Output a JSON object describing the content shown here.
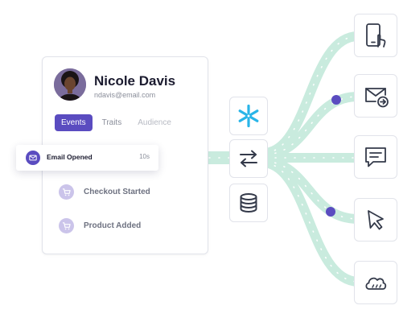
{
  "profile": {
    "name": "Nicole Davis",
    "email": "ndavis@email.com",
    "avatar_icon": "person-avatar",
    "tabs": [
      {
        "label": "Events",
        "active": true
      },
      {
        "label": "Traits",
        "active": false
      },
      {
        "label": "Audience",
        "active": false
      }
    ]
  },
  "events": {
    "highlighted": {
      "label": "Email Opened",
      "time": "10s",
      "icon": "mail-icon"
    },
    "items": [
      {
        "label": "Checkout Started",
        "icon": "cart-icon"
      },
      {
        "label": "Product Added",
        "icon": "cart-icon"
      }
    ]
  },
  "hub": {
    "icons": [
      "snowflake-icon",
      "transfer-arrows-icon",
      "database-icon"
    ]
  },
  "destinations": {
    "icons": [
      "mobile-tap-icon",
      "email-forward-icon",
      "chat-icon",
      "cursor-icon",
      "cloud-icon"
    ]
  },
  "colors": {
    "accent": "#5a4cc0",
    "flow": "#c9ebde",
    "icon_tint": "#cbc4ea",
    "snowflake": "#29b5e8",
    "text_dark": "#1b1b2f",
    "text_muted": "#8a8e9a"
  }
}
